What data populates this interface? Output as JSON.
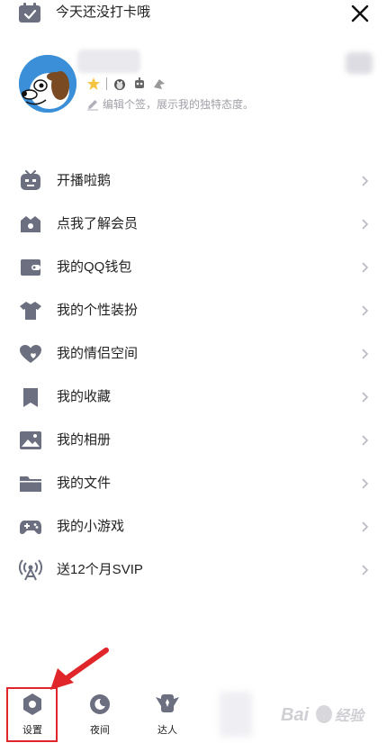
{
  "top": {
    "checkin_text": "今天还没打卡哦"
  },
  "profile": {
    "signature_placeholder": "编辑个签，展示我的独特态度。"
  },
  "menu": [
    {
      "label": "开播啦鹅",
      "icon": "tv-icon"
    },
    {
      "label": "点我了解会员",
      "icon": "crown-icon"
    },
    {
      "label": "我的QQ钱包",
      "icon": "wallet-icon"
    },
    {
      "label": "我的个性装扮",
      "icon": "shirt-icon"
    },
    {
      "label": "我的情侣空间",
      "icon": "heart-icon"
    },
    {
      "label": "我的收藏",
      "icon": "bookmark-icon"
    },
    {
      "label": "我的相册",
      "icon": "photo-icon"
    },
    {
      "label": "我的文件",
      "icon": "folder-icon"
    },
    {
      "label": "我的小游戏",
      "icon": "gamepad-icon"
    },
    {
      "label": "送12个月SVIP",
      "icon": "broadcast-icon"
    }
  ],
  "bottom": {
    "settings_label": "设置",
    "night_label": "夜间",
    "expert_label": "达人"
  },
  "colors": {
    "icon_gray": "#6b6f80",
    "highlight_red": "#e0262a",
    "text": "#222222",
    "muted": "#a0a0a8"
  }
}
